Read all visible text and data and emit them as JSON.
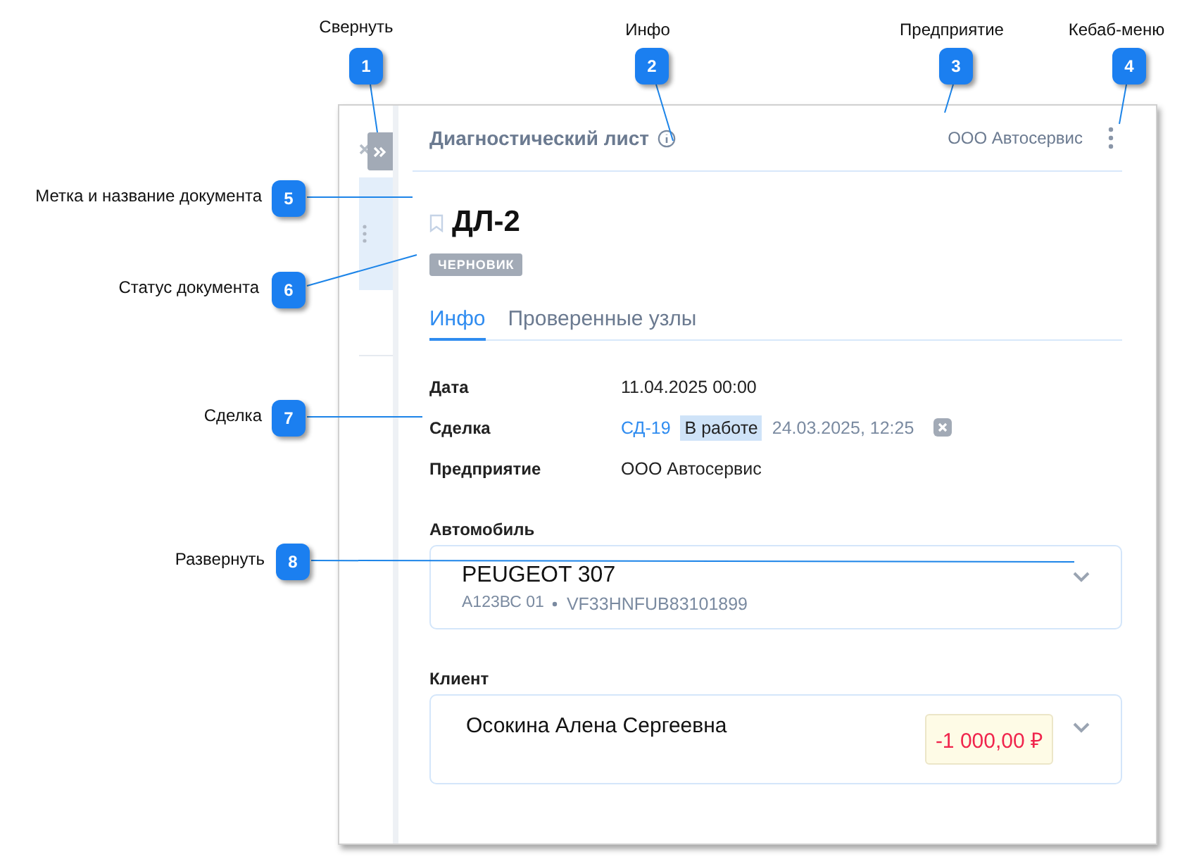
{
  "callouts": [
    {
      "number": "1",
      "label": "Свернуть"
    },
    {
      "number": "2",
      "label": "Инфо"
    },
    {
      "number": "3",
      "label": "Предприятие"
    },
    {
      "number": "4",
      "label": "Кебаб-меню"
    },
    {
      "number": "5",
      "label": "Метка и название документа"
    },
    {
      "number": "6",
      "label": "Статус документа"
    },
    {
      "number": "7",
      "label": "Сделка"
    },
    {
      "number": "8",
      "label": "Развернуть"
    }
  ],
  "header": {
    "title": "Диагностический лист",
    "company": "ООО Автосервис"
  },
  "document": {
    "title": "ДЛ-2",
    "bookmarked": false,
    "status": "ЧЕРНОВИК"
  },
  "tabs": [
    {
      "label": "Инфо",
      "selected": true
    },
    {
      "label": "Проверенные узлы",
      "selected": false
    }
  ],
  "fields": [
    {
      "kind": "text",
      "label": "Дата",
      "value": "11.04.2025 00:00"
    },
    {
      "kind": "deal",
      "label": "Сделка",
      "link": "СД-19",
      "status": "В работе",
      "date": "24.03.2025, 12:25"
    },
    {
      "kind": "text",
      "label": "Предприятие",
      "value": "ООО Автосервис"
    }
  ],
  "vehicle": {
    "section": "Автомобиль",
    "name": "PEUGEOT 307",
    "plate": "А123ВС 01",
    "vin": "VF33HNFUB83101899",
    "expanded": false
  },
  "client": {
    "section": "Клиент",
    "name": "Осокина Алена Сергеевна",
    "balance": "-1 000,00 ₽",
    "expanded": false
  }
}
